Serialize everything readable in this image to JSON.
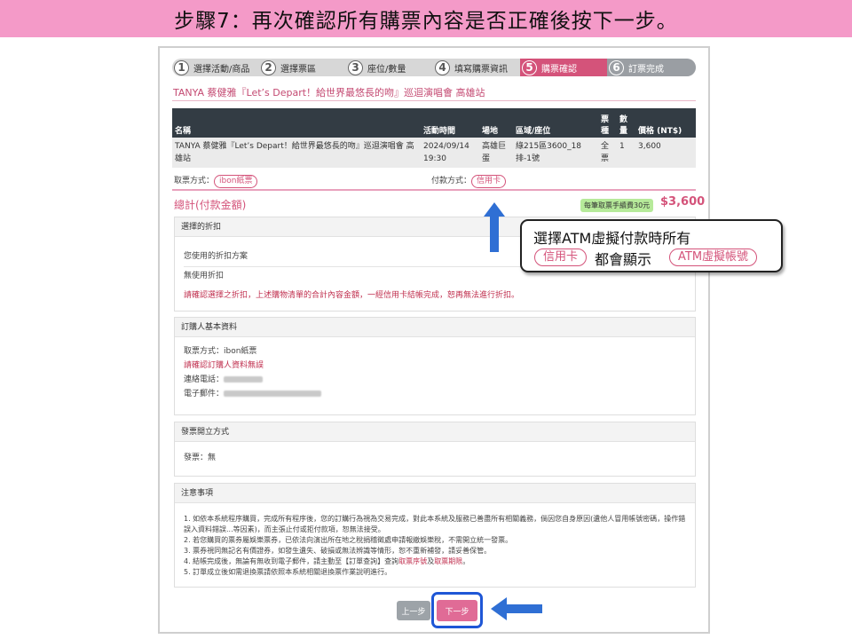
{
  "banner": "步驟7：再次確認所有購票內容是否正確後按下一步。",
  "steps": [
    {
      "num": "1",
      "label": "選擇活動/商品"
    },
    {
      "num": "2",
      "label": "選擇票區"
    },
    {
      "num": "3",
      "label": "座位/數量"
    },
    {
      "num": "4",
      "label": "填寫購票資訊"
    },
    {
      "num": "5",
      "label": "購票確認"
    },
    {
      "num": "6",
      "label": "訂票完成"
    }
  ],
  "event_title": "TANYA 蔡健雅『Let’s Depart！給世界最悠長的吻』巡迴演唱會 高雄站",
  "table": {
    "headers": {
      "name": "名稱",
      "time": "活動時間",
      "venue": "場地",
      "seat": "區域/座位",
      "type": "票種",
      "qty": "數量",
      "price": "價格 (NT$)"
    },
    "row": {
      "name": "TANYA 蔡健雅『Let’s Depart！給世界最悠長的吻』巡迴演唱會 高雄站",
      "time": "2024/09/14 19:30",
      "venue": "高雄巨蛋",
      "seat": "綠215區3600_18排-1號",
      "type": "全票",
      "qty": "1",
      "price": "3,600"
    }
  },
  "pickup": {
    "label": "取票方式：",
    "value": "ibon紙票"
  },
  "payment": {
    "label": "付款方式：",
    "value": "信用卡"
  },
  "total": {
    "label": "總計(付款金額)",
    "fee_badge": "每筆取票手續費30元",
    "value": "$3,600"
  },
  "discount": {
    "header": "選擇的折扣",
    "sub_header": "您使用的折扣方案",
    "value": "無使用折扣",
    "note": "請確認選擇之折扣，上述購物清單的合計內容金額，一經信用卡結帳完成，恕再無法進行折扣。"
  },
  "buyer": {
    "header": "訂購人基本資料",
    "pickup_line": "取票方式：ibon紙票",
    "confirm_note": "請確認訂購人資料無誤",
    "phone_label": "連絡電話：",
    "email_label": "電子郵件："
  },
  "invoice": {
    "header": "發票開立方式",
    "value": "發票：無"
  },
  "notes": {
    "header": "注意事項",
    "items": [
      "1. 如依本系統程序購買，完成所有程序後，您的訂購行為視為交易完成，對此本系統及服務已善盡所有相關義務，倘因您自身原因(遺他人冒用帳號密碼，操作錯誤入資料錯誤...等因素)，而主張止付或拒付款項，恕無法接受。",
      "2. 若您購買的票券屬娛樂票券，已依法向演出所在地之稅捐稽徵處申請報繳娛樂稅，不需開立統一發票。",
      "3. 票券視同無記名有價證券，如發生遺失、破損或無法辨識等情形，恕不重新補發，請妥善保管。",
      "4. 結帳完成後，無論有無收到電子郵件，請主動至【訂單查詢】查詢取票序號及取票期限。",
      "5. 訂單成立後如需退換票請依照本系統相關退換票作業說明進行。"
    ]
  },
  "buttons": {
    "prev": "上一步",
    "next": "下一步"
  },
  "callout": {
    "line1": "選擇ATM虛擬付款時所有",
    "pill1": "信用卡",
    "line2": "都會顯示",
    "pill2": "ATM虛擬帳號"
  },
  "colors": {
    "accent": "#d4537a",
    "banner": "#f49ac8",
    "highlight": "#1f57d6"
  }
}
